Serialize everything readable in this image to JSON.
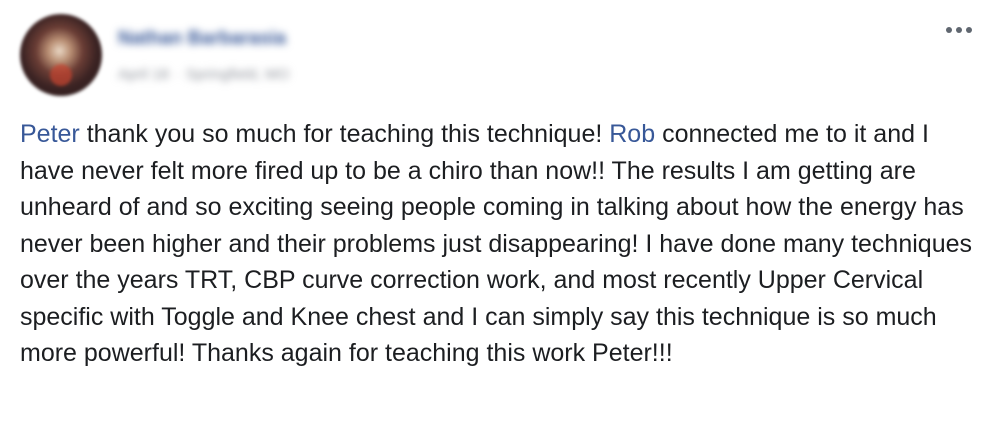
{
  "post": {
    "author": {
      "name": "Nathan Barbarasia",
      "avatar_icon": "profile-photo"
    },
    "meta": {
      "date": "April 18",
      "separator": "·",
      "location": "Springfield, MO"
    },
    "options_icon": "more-options-icon",
    "body": {
      "mention_1": "Peter",
      "text_1": " thank you so much for teaching this technique! ",
      "mention_2": "Rob",
      "text_2": " connected me to it and I have never felt more fired up to be a chiro than now!! The results I am getting are unheard of and so exciting seeing people coming in talking about how the energy has never been higher and their problems just disappearing! I have done many techniques over the years TRT, CBP curve correction work, and most recently Upper Cervical specific with Toggle and Knee chest and I can simply say this technique is so much more powerful! Thanks again for teaching this work Peter!!!"
    }
  },
  "colors": {
    "link": "#385898",
    "text": "#1c1e21",
    "meta": "#90949c",
    "icon": "#606770"
  }
}
